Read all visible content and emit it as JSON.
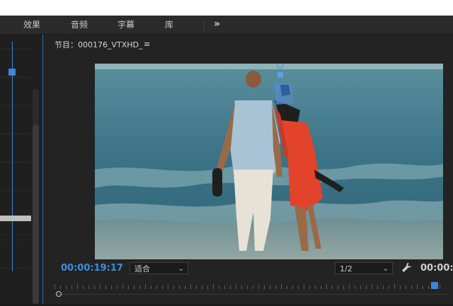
{
  "menubar": {
    "items": [
      {
        "label": "效果"
      },
      {
        "label": "音频"
      },
      {
        "label": "字幕"
      },
      {
        "label": "库"
      }
    ],
    "more_label": "»"
  },
  "program_monitor": {
    "tab_title": "节目：000176_VTXHD_",
    "menu_icon": "hamburger-icon",
    "current_timecode": "00:00:19:17",
    "zoom_select": "适合",
    "resolution_select": "1/2",
    "end_timecode": "00:00:2",
    "settings_icon": "wrench-icon"
  },
  "colors": {
    "accent": "#3a8ee6",
    "panel_bg": "#232323",
    "menubar_bg": "#2b2b2b"
  }
}
